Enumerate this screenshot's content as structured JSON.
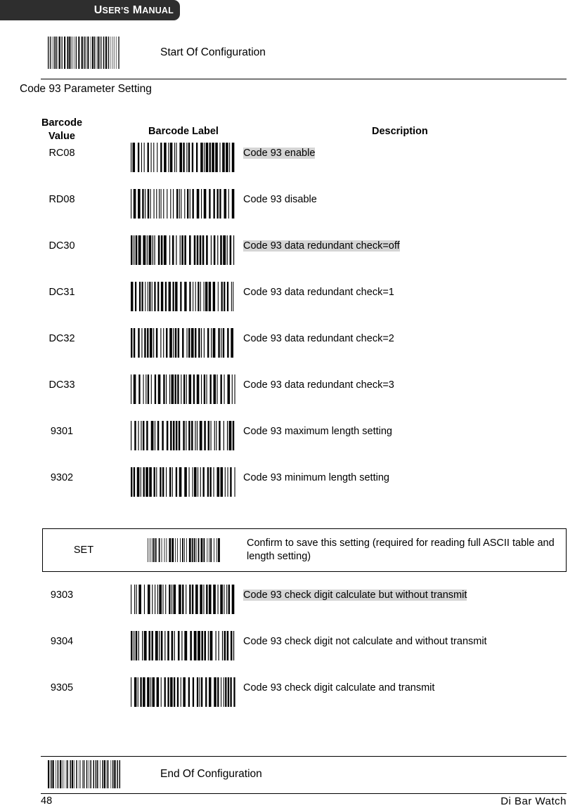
{
  "header": {
    "banner_title_part1": "U",
    "banner_title_rest1": "SER’S ",
    "banner_title_part2": "M",
    "banner_title_rest2": "ANUAL",
    "banner_title_full": "USER’S MANUAL"
  },
  "start_config": {
    "label": "Start Of Configuration",
    "barcode_name": "start-of-configuration-barcode"
  },
  "section": {
    "title": "Code 93 Parameter Setting"
  },
  "table": {
    "headers": {
      "value": "Barcode\nValue",
      "value_line1": "Barcode",
      "value_line2": "Value",
      "label": "Barcode Label",
      "description": "Description"
    },
    "rows": [
      {
        "value": "RC08",
        "description": "Code 93 enable",
        "highlighted": true
      },
      {
        "value": "RD08",
        "description": "Code 93 disable",
        "highlighted": false
      },
      {
        "value": "DC30",
        "description": "Code 93 data redundant check=off",
        "highlighted": true
      },
      {
        "value": "DC31",
        "description": "Code 93 data redundant check=1",
        "highlighted": false
      },
      {
        "value": "DC32",
        "description": "Code 93 data redundant check=2",
        "highlighted": false
      },
      {
        "value": "DC33",
        "description": "Code 93 data redundant check=3",
        "highlighted": false
      },
      {
        "value": "9301",
        "description": "Code 93 maximum length setting",
        "highlighted": false
      },
      {
        "value": "9302",
        "description": "Code 93 minimum length setting",
        "highlighted": false
      }
    ],
    "set_row": {
      "value": "SET",
      "description": "Confirm to save this setting (required for reading full ASCII table and length setting)"
    },
    "rows_after": [
      {
        "value": "9303",
        "description": "Code 93 check digit calculate but without transmit",
        "highlighted": true
      },
      {
        "value": "9304",
        "description": "Code 93 check digit not calculate and without transmit",
        "highlighted": false
      },
      {
        "value": "9305",
        "description": "Code 93 check digit calculate and transmit",
        "highlighted": false
      }
    ]
  },
  "end_config": {
    "label": "End Of Configuration",
    "barcode_name": "end-of-configuration-barcode"
  },
  "footer": {
    "page_number": "48",
    "brand": "Di  Bar  Watch"
  },
  "colors": {
    "banner_background": "#2e2e2e",
    "banner_text": "#ffffff",
    "highlight": "#d5d5d5",
    "text": "#000000",
    "rule": "#000000"
  }
}
